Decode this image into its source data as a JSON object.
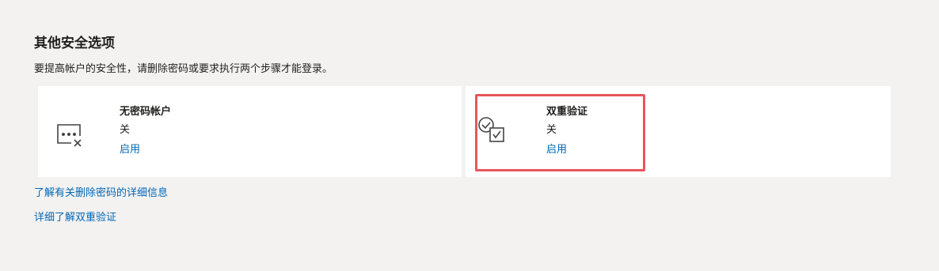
{
  "section": {
    "title": "其他安全选项",
    "description": "要提高帐户的安全性，请删除密码或要求执行两个步骤才能登录。"
  },
  "cards": [
    {
      "icon": "passwordless-icon",
      "title": "无密码帐户",
      "status": "关",
      "action": "启用"
    },
    {
      "icon": "two-step-verification-icon",
      "title": "双重验证",
      "status": "关",
      "action": "启用",
      "highlighted": true
    }
  ],
  "links": {
    "learn_remove_password": "了解有关删除密码的详细信息",
    "learn_two_step": "详细了解双重验证"
  },
  "colors": {
    "background": "#f3f2f1",
    "card": "#ffffff",
    "link": "#0067b8",
    "highlight": "#e8555b"
  }
}
